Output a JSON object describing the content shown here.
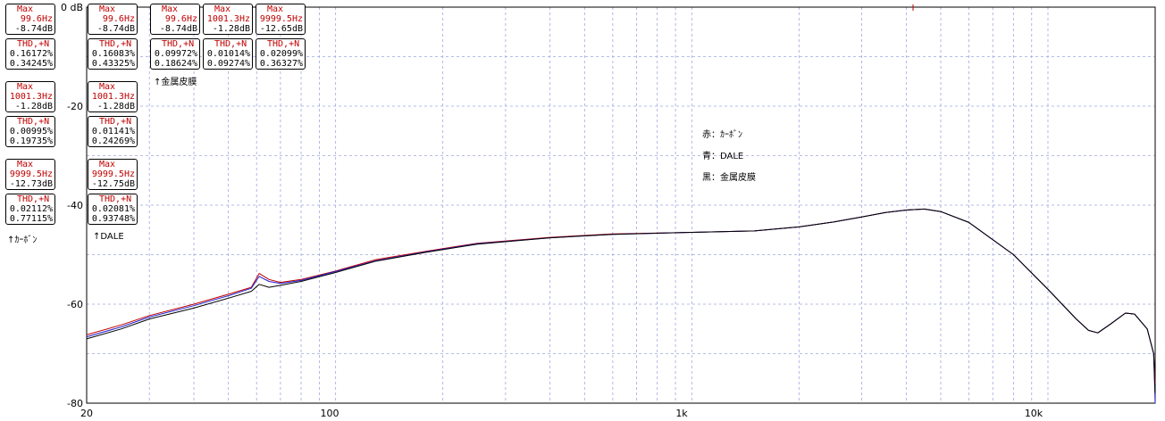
{
  "chart_data": {
    "type": "line",
    "xscale": "log",
    "xlim": [
      20,
      20000
    ],
    "ylim": [
      -80,
      0
    ],
    "x_ticks": [
      "20",
      "100",
      "1k",
      "10k"
    ],
    "y_ticks": [
      "0 dB",
      "-20",
      "-40",
      "-60",
      "-80"
    ],
    "legend": [
      "赤：ｶｰﾎﾞﾝ",
      "青：DALE",
      "黒：金属皮膜"
    ],
    "series": [
      {
        "color": "#c00000",
        "points": [
          [
            20,
            -66.2
          ],
          [
            25,
            -64.2
          ],
          [
            30,
            -62.3
          ],
          [
            40,
            -60
          ],
          [
            50,
            -58
          ],
          [
            58,
            -56.6
          ],
          [
            61,
            -53.8
          ],
          [
            65,
            -55
          ],
          [
            70,
            -55.6
          ],
          [
            80,
            -55
          ],
          [
            100,
            -53.3
          ],
          [
            130,
            -51
          ],
          [
            180,
            -49.3
          ],
          [
            250,
            -47.7
          ],
          [
            400,
            -46.5
          ],
          [
            600,
            -45.8
          ],
          [
            1000,
            -45.5
          ],
          [
            1500,
            -45.2
          ],
          [
            2000,
            -44.4
          ],
          [
            2500,
            -43.4
          ],
          [
            3000,
            -42.4
          ],
          [
            3500,
            -41.5
          ],
          [
            4000,
            -41
          ],
          [
            4500,
            -40.8
          ],
          [
            5000,
            -41.3
          ],
          [
            6000,
            -43.5
          ],
          [
            8000,
            -50
          ],
          [
            10000,
            -57
          ],
          [
            12000,
            -63
          ],
          [
            13000,
            -65.3
          ],
          [
            13800,
            -65.8
          ],
          [
            15000,
            -64
          ],
          [
            16500,
            -61.8
          ],
          [
            17500,
            -62
          ],
          [
            19000,
            -65
          ],
          [
            19800,
            -70
          ],
          [
            20000,
            -76
          ]
        ]
      },
      {
        "color": "#2020d0",
        "points": [
          [
            20,
            -66.6
          ],
          [
            25,
            -64.6
          ],
          [
            30,
            -62.6
          ],
          [
            40,
            -60.3
          ],
          [
            50,
            -58.3
          ],
          [
            58,
            -56.8
          ],
          [
            61,
            -54.4
          ],
          [
            65,
            -55.4
          ],
          [
            70,
            -55.8
          ],
          [
            80,
            -55.2
          ],
          [
            100,
            -53.4
          ],
          [
            130,
            -51.2
          ],
          [
            180,
            -49.4
          ],
          [
            250,
            -47.8
          ],
          [
            400,
            -46.6
          ],
          [
            600,
            -45.9
          ],
          [
            1000,
            -45.5
          ],
          [
            1500,
            -45.2
          ],
          [
            2000,
            -44.4
          ],
          [
            2500,
            -43.4
          ],
          [
            3000,
            -42.4
          ],
          [
            3500,
            -41.5
          ],
          [
            4000,
            -41
          ],
          [
            4500,
            -40.8
          ],
          [
            5000,
            -41.3
          ],
          [
            6000,
            -43.5
          ],
          [
            8000,
            -50
          ],
          [
            10000,
            -57
          ],
          [
            12000,
            -63
          ],
          [
            13000,
            -65.3
          ],
          [
            13800,
            -65.8
          ],
          [
            15000,
            -64
          ],
          [
            16500,
            -61.8
          ],
          [
            17500,
            -62
          ],
          [
            19000,
            -65
          ],
          [
            19800,
            -70
          ],
          [
            20000,
            -80
          ]
        ]
      },
      {
        "color": "#000000",
        "points": [
          [
            20,
            -67
          ],
          [
            25,
            -65
          ],
          [
            30,
            -63
          ],
          [
            40,
            -60.8
          ],
          [
            50,
            -58.8
          ],
          [
            58,
            -57.4
          ],
          [
            61,
            -56
          ],
          [
            65,
            -56.6
          ],
          [
            70,
            -56.2
          ],
          [
            80,
            -55.4
          ],
          [
            100,
            -53.6
          ],
          [
            130,
            -51.3
          ],
          [
            180,
            -49.5
          ],
          [
            250,
            -47.9
          ],
          [
            400,
            -46.6
          ],
          [
            600,
            -45.9
          ],
          [
            1000,
            -45.5
          ],
          [
            1500,
            -45.2
          ],
          [
            2000,
            -44.4
          ],
          [
            2500,
            -43.4
          ],
          [
            3000,
            -42.4
          ],
          [
            3500,
            -41.5
          ],
          [
            4000,
            -41
          ],
          [
            4500,
            -40.8
          ],
          [
            5000,
            -41.3
          ],
          [
            6000,
            -43.5
          ],
          [
            8000,
            -50
          ],
          [
            10000,
            -57
          ],
          [
            12000,
            -63
          ],
          [
            13000,
            -65.3
          ],
          [
            13800,
            -65.8
          ],
          [
            15000,
            -64
          ],
          [
            16500,
            -61.8
          ],
          [
            17500,
            -62
          ],
          [
            19000,
            -65
          ],
          [
            19800,
            -70
          ],
          [
            20000,
            -78
          ]
        ]
      }
    ]
  },
  "readouts": {
    "carbon": {
      "caption": "↑ｶｰﾎﾞﾝ",
      "boxes": [
        {
          "head": "Max",
          "v1": "99.6Hz",
          "v2": "-8.74dB",
          "max": true
        },
        {
          "head": "THD,+N",
          "v1": "0.16172%",
          "v2": "0.34245%",
          "max": false
        },
        {
          "head": "Max",
          "v1": "1001.3Hz",
          "v2": "-1.28dB",
          "max": true
        },
        {
          "head": "THD,+N",
          "v1": "0.00995%",
          "v2": "0.19735%",
          "max": false
        },
        {
          "head": "Max",
          "v1": "9999.5Hz",
          "v2": "-12.73dB",
          "max": true
        },
        {
          "head": "THD,+N",
          "v1": "0.02112%",
          "v2": "0.77115%",
          "max": false
        }
      ]
    },
    "dale": {
      "caption": "↑DALE",
      "boxes": [
        {
          "head": "Max",
          "v1": "99.6Hz",
          "v2": "-8.74dB",
          "max": true
        },
        {
          "head": "THD,+N",
          "v1": "0.16083%",
          "v2": "0.43325%",
          "max": false
        },
        {
          "head": "Max",
          "v1": "1001.3Hz",
          "v2": "-1.28dB",
          "max": true
        },
        {
          "head": "THD,+N",
          "v1": "0.01141%",
          "v2": "0.24269%",
          "max": false
        },
        {
          "head": "Max",
          "v1": "9999.5Hz",
          "v2": "-12.75dB",
          "max": true
        },
        {
          "head": "THD,+N",
          "v1": "0.02081%",
          "v2": "0.93748%",
          "max": false
        }
      ]
    },
    "metal": {
      "caption": "↑金属皮膜",
      "boxes": [
        {
          "head": "Max",
          "v1": "99.6Hz",
          "v2": "-8.74dB",
          "max": true
        },
        {
          "head": "THD,+N",
          "v1": "0.09972%",
          "v2": "0.18624%",
          "max": false
        },
        {
          "head": "Max",
          "v1": "1001.3Hz",
          "v2": "-1.28dB",
          "max": true
        },
        {
          "head": "THD,+N",
          "v1": "0.01014%",
          "v2": "0.09274%",
          "max": false
        },
        {
          "head": "Max",
          "v1": "9999.5Hz",
          "v2": "-12.65dB",
          "max": true
        },
        {
          "head": "THD,+N",
          "v1": "0.02099%",
          "v2": "0.36327%",
          "max": false
        }
      ]
    }
  }
}
